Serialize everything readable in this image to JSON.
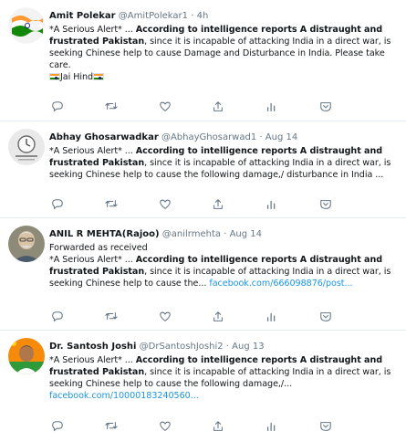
{
  "tweets": [
    {
      "name": "Amit Polekar",
      "handle": "@AmitPolekar1",
      "sep": "·",
      "time": "4h",
      "p1": "*A Serious Alert* ...  ",
      "b1": "According to intelligence reports A distraught and frustrated Pakistan",
      "p2": ", since it is incapable of attacking India in a direct war, is seeking Chinese help to cause Damage and Disturbance in India. Please take care.",
      "p3": "Jai Hind",
      "avatar": "india-flag-avatar"
    },
    {
      "name": "Abhay Ghosarwadkar",
      "handle": "@AbhayGhosarwad1",
      "sep": "·",
      "time": "Aug 14",
      "p1": "*A Serious Alert* ...  ",
      "b1": "According to intelligence reports A distraught and frustrated Pakistan",
      "p2": ", since it is incapable of attacking India in a direct war, is seeking Chinese help to cause the following damage,/ disturbance in India ...",
      "avatar": "clock-avatar"
    },
    {
      "name": "ANIL R MEHTA(Rajoo)",
      "handle": "@anilrmehta",
      "sep": "·",
      "time": "Aug 14",
      "p0": "Forwarded as received",
      "p1": "*A Serious Alert* ...  ",
      "b1": "According to intelligence reports A distraught and frustrated Pakistan",
      "p2": ", since it is incapable of attacking India in a direct war, is seeking Chinese help to cause the... ",
      "link": "facebook.com/666098876/post...",
      "avatar": "person-avatar"
    },
    {
      "name": "Dr. Santosh Joshi",
      "handle": "@DrSantoshJoshi2",
      "sep": "·",
      "time": "Aug 13",
      "p1": "*A Serious Alert* ...  ",
      "b1": "According to intelligence reports A distraught and frustrated Pakistan",
      "p2": ", since it is incapable of attacking India in a direct war, is seeking Chinese help to cause the following damage,/...",
      "link": "facebook.com/10000183240560...",
      "avatar": "saffron-avatar"
    }
  ],
  "actions": [
    "reply-icon",
    "retweet-icon",
    "like-icon",
    "share-icon",
    "analytics-icon",
    "email-icon"
  ],
  "colors": {
    "link": "#1b95e0",
    "muted": "#657786",
    "divider": "#e6ecf0",
    "icon": "#657786"
  }
}
